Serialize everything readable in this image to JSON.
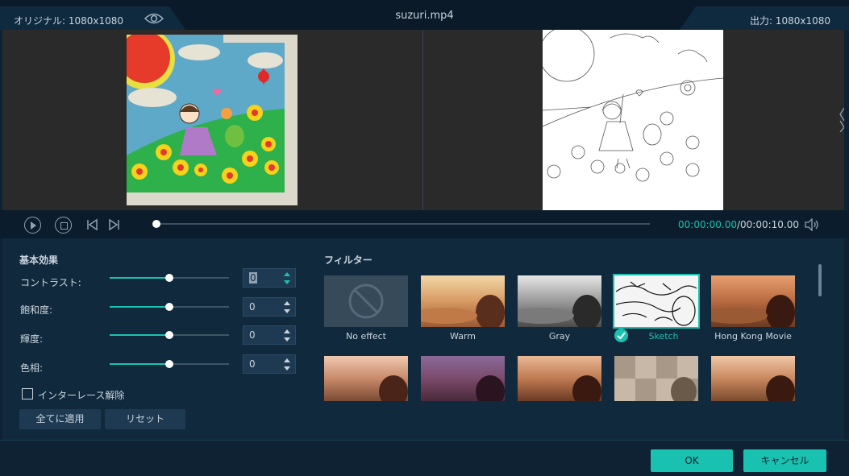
{
  "header": {
    "original_label": "オリジナル: 1080x1080",
    "file_title": "suzuri.mp4",
    "output_label": "出力: 1080x1080"
  },
  "transport": {
    "time_current": "00:00:00.00",
    "time_total": "/00:00:10.00",
    "progress": 0.0
  },
  "basic": {
    "title": "基本効果",
    "rows": [
      {
        "label": "コントラスト:",
        "value": "0",
        "level": 0.5
      },
      {
        "label": "飽和度:",
        "value": "0",
        "level": 0.5
      },
      {
        "label": "輝度:",
        "value": "0",
        "level": 0.5
      },
      {
        "label": "色相:",
        "value": "0",
        "level": 0.5
      }
    ],
    "deinterlace_label": "インターレース解除",
    "apply_all_label": "全てに適用",
    "reset_label": "リセット"
  },
  "filters": {
    "title": "フィルター",
    "items": [
      {
        "label": "No effect",
        "selected": false
      },
      {
        "label": "Warm",
        "selected": false
      },
      {
        "label": "Gray",
        "selected": false
      },
      {
        "label": "Sketch",
        "selected": true
      },
      {
        "label": "Hong Kong Movie",
        "selected": false
      },
      {
        "label": "",
        "selected": false
      },
      {
        "label": "",
        "selected": false
      },
      {
        "label": "",
        "selected": false
      },
      {
        "label": "",
        "selected": false
      },
      {
        "label": "",
        "selected": false
      }
    ]
  },
  "footer": {
    "ok_label": "OK",
    "cancel_label": "キャンセル"
  },
  "colors": {
    "accent": "#19c2b0",
    "background": "#0e2233",
    "panel": "#11293d"
  }
}
